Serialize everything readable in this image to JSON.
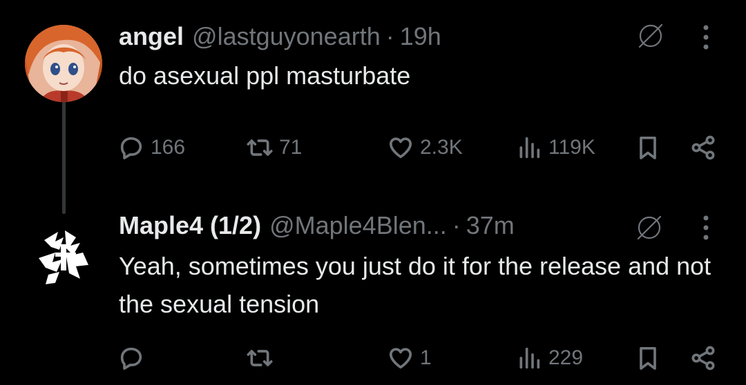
{
  "tweets": [
    {
      "name": "angel",
      "handle": "@lastguyonearth",
      "separator": "·",
      "time": "19h",
      "text": "do asexual ppl masturbate",
      "avatar": "anime-character-avatar",
      "stats": {
        "replies": "166",
        "retweets": "71",
        "likes": "2.3K",
        "views": "119K"
      }
    },
    {
      "name": "Maple4 (1/2)",
      "handle": "@Maple4Blen...",
      "separator": "·",
      "time": "37m",
      "text": "Yeah, sometimes you just do it for the release and not the sexual tension",
      "avatar": "maple4-logo-avatar",
      "stats": {
        "replies": "",
        "retweets": "",
        "likes": "1",
        "views": "229"
      }
    }
  ],
  "icons": [
    "reply-icon",
    "retweet-icon",
    "like-icon",
    "views-icon",
    "bookmark-icon",
    "share-icon",
    "grok-icon",
    "more-icon"
  ],
  "colors": {
    "background": "#000000",
    "primary_text": "#e7e9ea",
    "secondary_text": "#71767b",
    "thread_line": "#333639"
  }
}
